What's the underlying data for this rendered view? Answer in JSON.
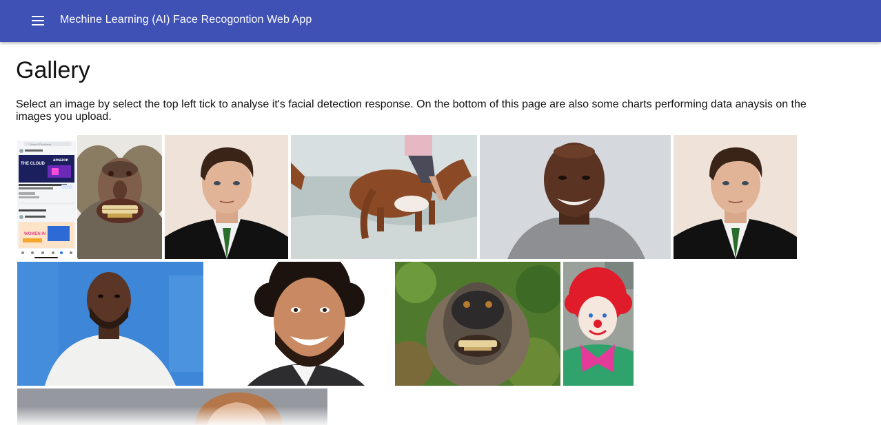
{
  "appbar": {
    "title": "Mechine Learning (AI) Face Recogontion Web App",
    "menu_icon": "hamburger-menu-icon",
    "color": "#4051b5"
  },
  "page": {
    "title": "Gallery",
    "description": "Select an image by select the top left tick to analyse it's facial detection response. On the bottom of this page are also some charts performing data anaysis on the images you upload."
  },
  "phone_screenshot": {
    "search_placeholder": "Search Facebook",
    "banner_line1": "THE CLOUD",
    "banner_brand": "amazon",
    "banner_line2": "WOMEN IN"
  },
  "gallery": [
    {
      "subject": "phone-screenshot"
    },
    {
      "subject": "baboon"
    },
    {
      "subject": "man-in-suit"
    },
    {
      "subject": "horse-in-water"
    },
    {
      "subject": "smiling-bald-man"
    },
    {
      "subject": "man-in-suit"
    },
    {
      "subject": "bearded-man-blue-backdrop"
    },
    {
      "subject": "curly-haired-man-smiling"
    },
    {
      "subject": "monkey-selfie"
    },
    {
      "subject": "clown"
    },
    {
      "subject": "man-grey-backdrop"
    }
  ]
}
